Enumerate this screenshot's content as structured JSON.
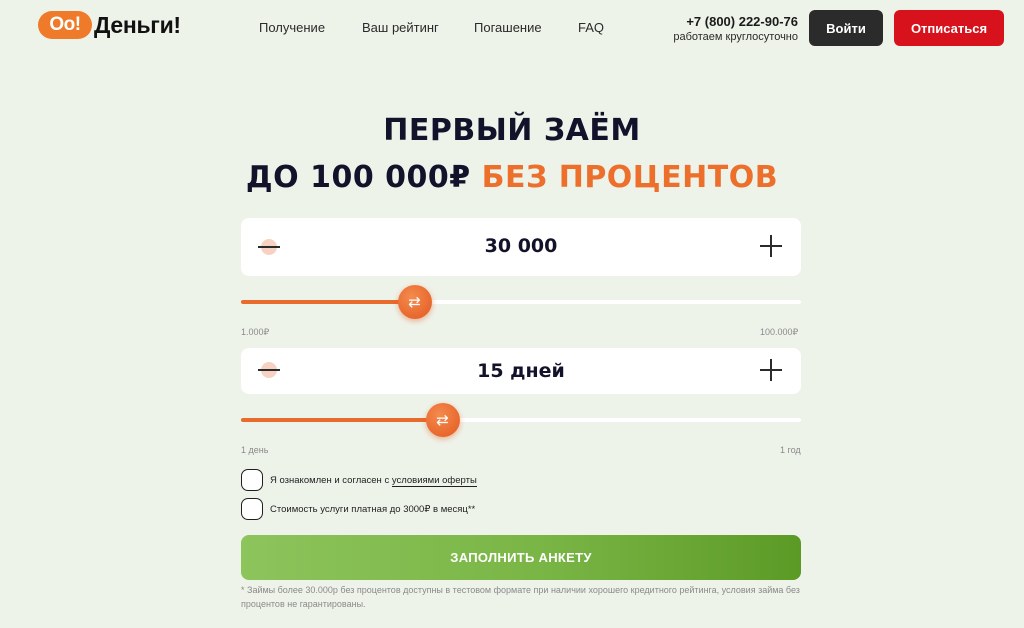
{
  "header": {
    "logo": {
      "badge": "Oo!",
      "text": "Деньги!"
    },
    "nav": [
      "Получение",
      "Ваш рейтинг",
      "Погашение",
      "FAQ"
    ],
    "phone": "+7 (800) 222-90-76",
    "phone_hours": "работаем круглосуточно",
    "login_label": "Войти",
    "unsubscribe_label": "Отписаться"
  },
  "hero": {
    "line1": "ПЕРВЫЙ ЗАЁМ",
    "line2_main": "ДО 100 000₽",
    "line2_accent": "БЕЗ ПРОЦЕНТОВ",
    "accent_color": "#ec6f2b"
  },
  "amount": {
    "value": "30 000",
    "min_label": "1.000₽",
    "max_label": "100.000₽",
    "slider_fraction": 0.31
  },
  "term": {
    "value": "15 дней",
    "min_label": "1 день",
    "max_label": "1 год",
    "slider_fraction": 0.36
  },
  "agreements": {
    "offer_prefix": "Я ознакомлен и согласен с ",
    "offer_link": "условиями оферты",
    "service_cost": "Стоимость услуги платная до 3000₽ в месяц**"
  },
  "cta_label": "ЗАПОЛНИТЬ АНКЕТУ",
  "footnote": "* Займы более 30.000р без процентов доступны в тестовом формате при наличии хорошего кредитного рейтинга, условия займа без процентов не гарантированы.",
  "colors": {
    "background": "#eef3ea",
    "accent": "#ec6f2b",
    "login_bg": "#2b2b2b",
    "unsubscribe_bg": "#d7121c",
    "cta": "#79b545"
  },
  "icons": [
    "minus-icon",
    "plus-icon",
    "swap-arrows-icon"
  ]
}
